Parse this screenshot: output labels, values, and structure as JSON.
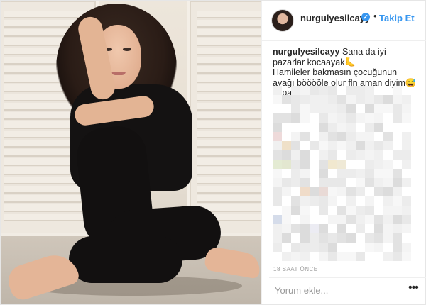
{
  "post": {
    "photo_alt": "",
    "author": {
      "username": "nurgulyesilcayy",
      "verified_glyph": "✓",
      "separator": "•",
      "follow_label": "Takip Et"
    },
    "caption": {
      "username": "nurgulyesilcayy",
      "line1": "Sana da iyi pazarlar kocaayak🦶",
      "line2": "Hamileler bakmasın çocuğunun ayağı bööööle olur fln aman diyim😅kapat kapat"
    },
    "timestamp": "18 SAAT ÖNCE",
    "comment_box": {
      "placeholder": "Yorum ekle..."
    },
    "more_options_glyph": "•••"
  },
  "colors": {
    "accent": "#3897f0",
    "text": "#262626",
    "muted": "#999999",
    "border": "#efefef"
  },
  "icons": {
    "verified": "verified-badge-icon",
    "more": "more-options-icon"
  }
}
